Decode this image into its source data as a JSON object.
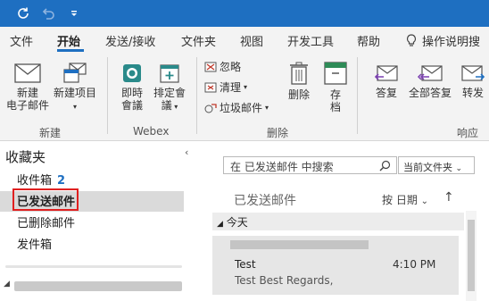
{
  "titlebar": {
    "icons": [
      "refresh-icon",
      "undo-icon",
      "quick-access-dropdown-icon"
    ],
    "bg_color": "#1e6fc1"
  },
  "tabs": [
    {
      "label": "文件"
    },
    {
      "label": "开始"
    },
    {
      "label": "发送/接收"
    },
    {
      "label": "文件夹"
    },
    {
      "label": "视图"
    },
    {
      "label": "开发工具"
    },
    {
      "label": "帮助"
    },
    {
      "label": "操作说明搜"
    }
  ],
  "active_tab": "开始",
  "ribbon": {
    "new_group": {
      "label": "新建",
      "new_email_line1": "新建",
      "new_email_line2": "电子邮件",
      "new_items": "新建项目"
    },
    "webex_group": {
      "label": "Webex",
      "instant_meeting_line1": "即時",
      "instant_meeting_line2": "會議",
      "schedule_meeting_line1": "排定會",
      "schedule_meeting_line2": "議"
    },
    "delete_group": {
      "label": "删除",
      "ignore": "忽略",
      "cleanup": "清理",
      "junk": "垃圾邮件",
      "delete": "删除",
      "archive_line1": "存",
      "archive_line2": "档"
    },
    "respond_group": {
      "label": "响应",
      "reply": "答复",
      "reply_all": "全部答复",
      "forward": "转发"
    }
  },
  "folders": {
    "favorites_title": "收藏夹",
    "inbox_label": "收件箱",
    "inbox_count": "2",
    "sent_label": "已发送邮件",
    "deleted_label": "已删除邮件",
    "outbox_label": "发件箱"
  },
  "message_list": {
    "search_placeholder": "在 已发送邮件 中搜索",
    "scope": "当前文件夹",
    "title": "已发送邮件",
    "sort_label": "按 日期",
    "group_header": "今天",
    "items": [
      {
        "subject": "Test",
        "preview": "Test  Best Regards,",
        "time": "4:10 PM"
      }
    ]
  },
  "colors": {
    "accent": "#1e6fc1",
    "selection_border": "#e02020",
    "selection_bg": "#dadada"
  }
}
